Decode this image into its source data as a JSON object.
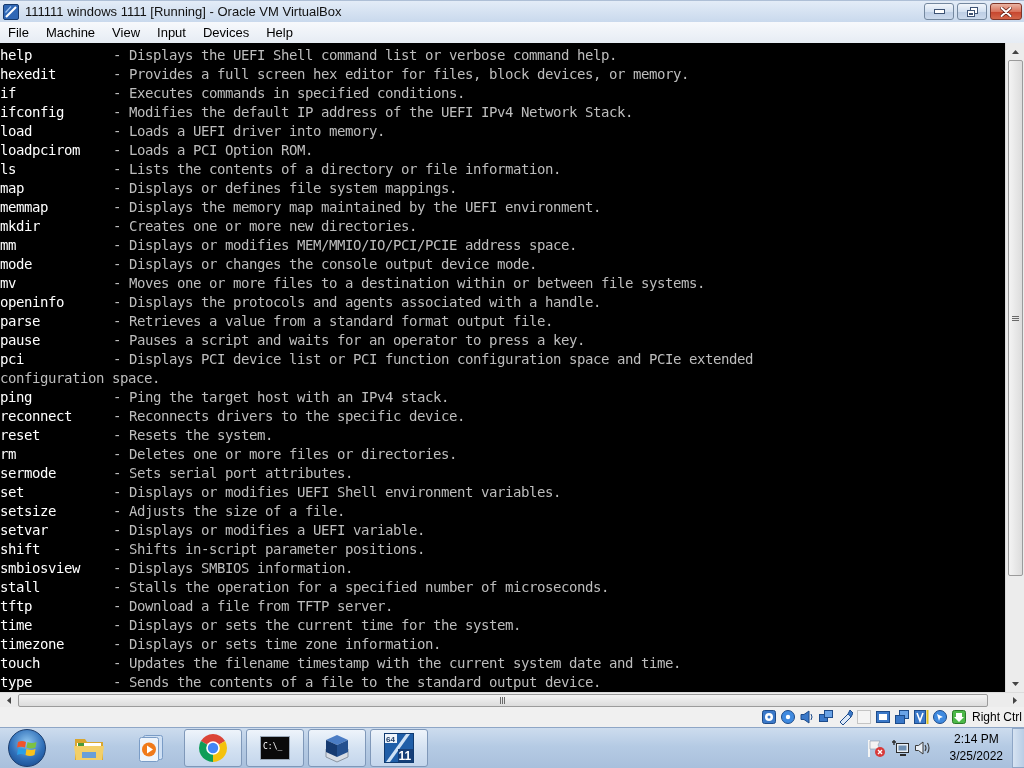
{
  "window": {
    "title": "111111 windows 1111 [Running] - Oracle VM VirtualBox"
  },
  "menu_bar": {
    "items": [
      "File",
      "Machine",
      "View",
      "Input",
      "Devices",
      "Help"
    ]
  },
  "terminal": {
    "lines": [
      {
        "kind": "entry",
        "command": "help",
        "description": "- Displays the UEFI Shell command list or verbose command help."
      },
      {
        "kind": "entry",
        "command": "hexedit",
        "description": "- Provides a full screen hex editor for files, block devices, or memory."
      },
      {
        "kind": "entry",
        "command": "if",
        "description": "- Executes commands in specified conditions."
      },
      {
        "kind": "entry",
        "command": "ifconfig",
        "description": "- Modifies the default IP address of the UEFI IPv4 Network Stack."
      },
      {
        "kind": "entry",
        "command": "load",
        "description": "- Loads a UEFI driver into memory."
      },
      {
        "kind": "entry",
        "command": "loadpcirom",
        "description": "- Loads a PCI Option ROM."
      },
      {
        "kind": "entry",
        "command": "ls",
        "description": "- Lists the contents of a directory or file information."
      },
      {
        "kind": "entry",
        "command": "map",
        "description": "- Displays or defines file system mappings."
      },
      {
        "kind": "entry",
        "command": "memmap",
        "description": "- Displays the memory map maintained by the UEFI environment."
      },
      {
        "kind": "entry",
        "command": "mkdir",
        "description": "- Creates one or more new directories."
      },
      {
        "kind": "entry",
        "command": "mm",
        "description": "- Displays or modifies MEM/MMIO/IO/PCI/PCIE address space."
      },
      {
        "kind": "entry",
        "command": "mode",
        "description": "- Displays or changes the console output device mode."
      },
      {
        "kind": "entry",
        "command": "mv",
        "description": "- Moves one or more files to a destination within or between file systems."
      },
      {
        "kind": "entry",
        "command": "openinfo",
        "description": "- Displays the protocols and agents associated with a handle."
      },
      {
        "kind": "entry",
        "command": "parse",
        "description": "- Retrieves a value from a standard format output file."
      },
      {
        "kind": "entry",
        "command": "pause",
        "description": "- Pauses a script and waits for an operator to press a key."
      },
      {
        "kind": "entry",
        "command": "pci",
        "description": "- Displays PCI device list or PCI function configuration space and PCIe extended"
      },
      {
        "kind": "wrap",
        "text": "configuration space."
      },
      {
        "kind": "entry",
        "command": "ping",
        "description": "- Ping the target host with an IPv4 stack."
      },
      {
        "kind": "entry",
        "command": "reconnect",
        "description": "- Reconnects drivers to the specific device."
      },
      {
        "kind": "entry",
        "command": "reset",
        "description": "- Resets the system."
      },
      {
        "kind": "entry",
        "command": "rm",
        "description": "- Deletes one or more files or directories."
      },
      {
        "kind": "entry",
        "command": "sermode",
        "description": "- Sets serial port attributes."
      },
      {
        "kind": "entry",
        "command": "set",
        "description": "- Displays or modifies UEFI Shell environment variables."
      },
      {
        "kind": "entry",
        "command": "setsize",
        "description": "- Adjusts the size of a file."
      },
      {
        "kind": "entry",
        "command": "setvar",
        "description": "- Displays or modifies a UEFI variable."
      },
      {
        "kind": "entry",
        "command": "shift",
        "description": "- Shifts in-script parameter positions."
      },
      {
        "kind": "entry",
        "command": "smbiosview",
        "description": "- Displays SMBIOS information."
      },
      {
        "kind": "entry",
        "command": "stall",
        "description": "- Stalls the operation for a specified number of microseconds."
      },
      {
        "kind": "entry",
        "command": "tftp",
        "description": "- Download a file from TFTP server."
      },
      {
        "kind": "entry",
        "command": "time",
        "description": "- Displays or sets the current time for the system."
      },
      {
        "kind": "entry",
        "command": "timezone",
        "description": "- Displays or sets time zone information."
      },
      {
        "kind": "entry",
        "command": "touch",
        "description": "- Updates the filename timestamp with the current system date and time."
      },
      {
        "kind": "entry",
        "command": "type",
        "description": "- Sends the contents of a file to the standard output device."
      }
    ]
  },
  "status_bar": {
    "host_key": "Right Ctrl"
  },
  "taskbar": {
    "apps": [
      {
        "kind": "folder",
        "running": false
      },
      {
        "kind": "player",
        "running": false
      },
      {
        "kind": "browser",
        "running": true
      },
      {
        "kind": "console",
        "running": true,
        "label": "C:\\_"
      },
      {
        "kind": "cube",
        "running": true
      },
      {
        "kind": "tile",
        "running": true,
        "badge": "64",
        "label": "11"
      }
    ],
    "clock": {
      "time": "2:14 PM",
      "date": "3/25/2022"
    }
  }
}
